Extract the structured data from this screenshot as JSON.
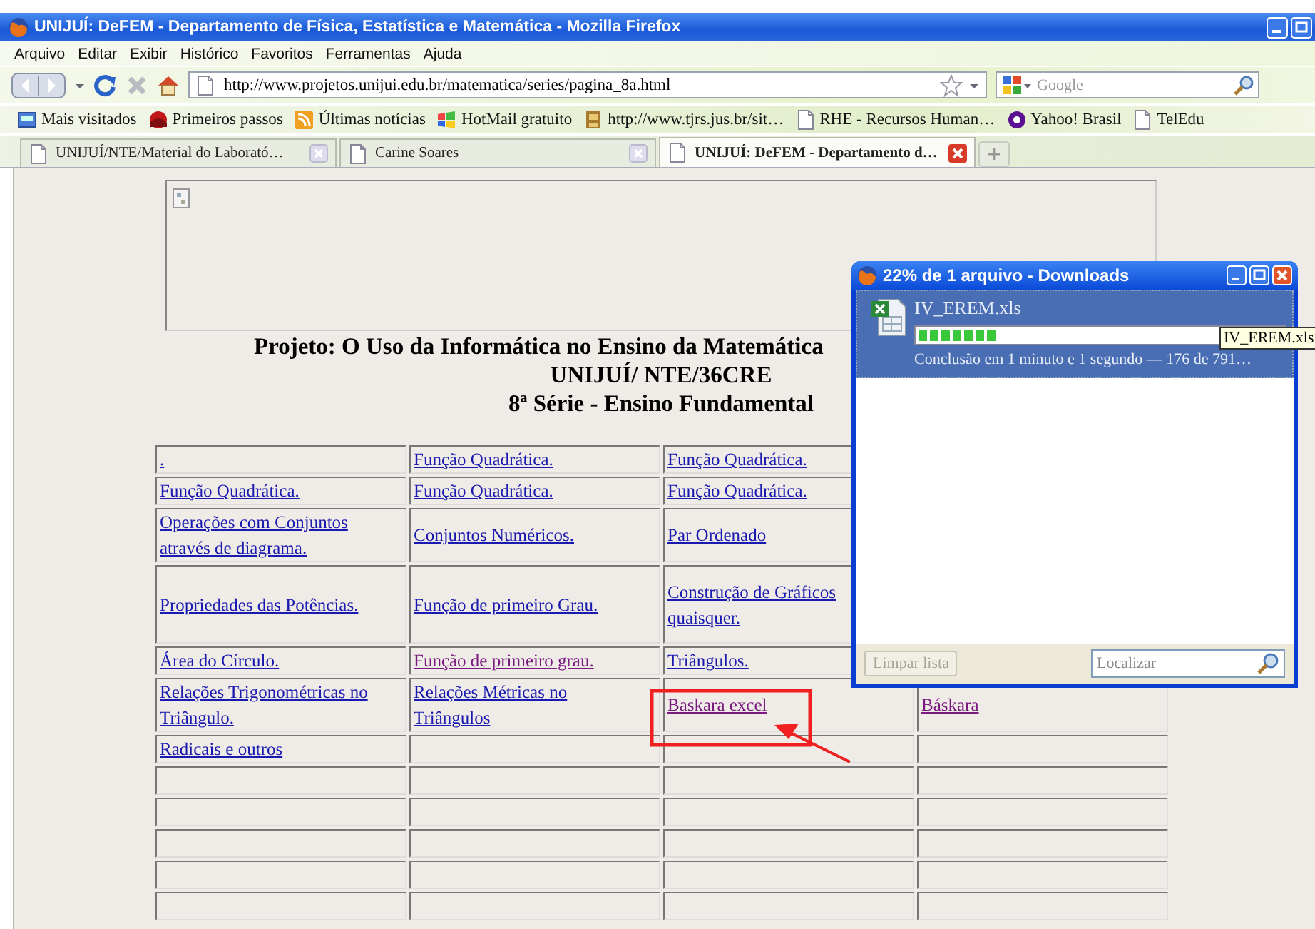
{
  "window": {
    "title": "UNIJUÍ: DeFEM - Departamento de Física, Estatística e Matemática - Mozilla Firefox"
  },
  "menu": [
    "Arquivo",
    "Editar",
    "Exibir",
    "Histórico",
    "Favoritos",
    "Ferramentas",
    "Ajuda"
  ],
  "toolbar": {
    "url": "http://www.projetos.unijui.edu.br/matematica/series/pagina_8a.html",
    "search_placeholder": "Google"
  },
  "bookmarks": [
    {
      "label": "Mais visitados",
      "kind": "smart"
    },
    {
      "label": "Primeiros passos",
      "kind": "firefox"
    },
    {
      "label": "Últimas notícias",
      "kind": "feed"
    },
    {
      "label": "HotMail gratuito",
      "kind": "windows"
    },
    {
      "label": "http://www.tjrs.jus.br/sit…",
      "kind": "site"
    },
    {
      "label": "RHE - Recursos Human…",
      "kind": "page"
    },
    {
      "label": "Yahoo! Brasil",
      "kind": "yahoo"
    },
    {
      "label": "TelEdu",
      "kind": "page"
    }
  ],
  "tabs": [
    {
      "label": "UNIJUÍ/NTE/Material do Laborató…",
      "selected": false
    },
    {
      "label": "Carine Soares",
      "selected": false
    },
    {
      "label": "UNIJUÍ: DeFEM - Departamento d…",
      "selected": true
    }
  ],
  "page": {
    "headings": [
      "Projeto: O Uso da Informática no Ensino da Matemática",
      "UNIJUÍ/ NTE/36CRE",
      "8ª Série - Ensino Fundamental"
    ],
    "table": {
      "rows": [
        [
          {
            "text": ".",
            "visited": false
          },
          {
            "text": "Função Quadrática.",
            "visited": false
          },
          {
            "text": "Função Quadrática.",
            "visited": false
          }
        ],
        [
          {
            "text": "Função Quadrática.",
            "visited": false
          },
          {
            "text": "Função Quadrática.",
            "visited": false
          },
          {
            "text": "Função Quadrática.",
            "visited": false
          }
        ],
        [
          {
            "text": "Operações com Conjuntos através de diagrama.",
            "visited": false
          },
          {
            "text": "Conjuntos Numéricos.",
            "visited": false
          },
          {
            "text": "Par Ordenado",
            "visited": false
          }
        ],
        [
          {
            "text": "Propriedades das Potências.",
            "visited": false
          },
          {
            "text": "Função de primeiro Grau.",
            "visited": false
          },
          {
            "text": "Construção de Gráficos quaisquer.",
            "visited": false
          }
        ],
        [
          {
            "text": "Área do Círculo.",
            "visited": false
          },
          {
            "text": "Função de primeiro grau.",
            "visited": true
          },
          {
            "text": "Triângulos.",
            "visited": false
          }
        ],
        [
          {
            "text": "Relações Trigonométricas no Triângulo.",
            "visited": false
          },
          {
            "text": "Relações Métricas no Triângulos",
            "visited": false
          },
          {
            "text": "Baskara  excel",
            "visited": true
          },
          {
            "text": "Báskara",
            "visited": true
          }
        ],
        [
          {
            "text": "Radicais e outros",
            "visited": false
          },
          null,
          null,
          null
        ],
        [
          null,
          null,
          null,
          null
        ],
        [
          null,
          null,
          null,
          null
        ],
        [
          null,
          null,
          null,
          null
        ],
        [
          null,
          null,
          null,
          null
        ],
        [
          null,
          null,
          null,
          null
        ]
      ]
    }
  },
  "downloads": {
    "title": "22% de 1 arquivo - Downloads",
    "items": [
      {
        "filename": "IV_EREM.xls",
        "level": 0.22,
        "status": "Conclusão em 1 minuto e 1 segundo — 176 de 791…",
        "selected": true
      }
    ],
    "tooltip": "IV_EREM.xls",
    "clear_button": {
      "label": "Limpar lista",
      "disabled": true
    },
    "search_placeholder": "Localizar"
  }
}
